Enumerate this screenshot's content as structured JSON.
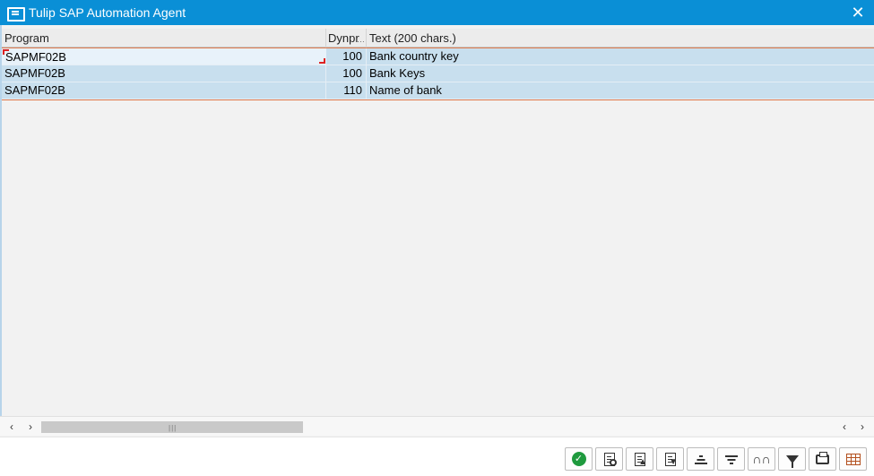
{
  "window": {
    "title": "Tulip SAP Automation Agent",
    "close_icon": "close-icon",
    "app_icon": "window-icon",
    "accent_color": "#0a8fd6"
  },
  "grid": {
    "columns": [
      {
        "key": "program",
        "label": "Program"
      },
      {
        "key": "dynpr",
        "label": "Dynpr"
      },
      {
        "key": "text",
        "label": "Text (200 chars.)"
      }
    ],
    "rows": [
      {
        "program": "SAPMF02B",
        "dynpr": "100",
        "text": "Bank country key"
      },
      {
        "program": "SAPMF02B",
        "dynpr": "100",
        "text": "Bank Keys"
      },
      {
        "program": "SAPMF02B",
        "dynpr": "110",
        "text": "Name of bank"
      }
    ],
    "selection_color": "#c8dfee"
  },
  "scrollbar": {
    "left_arrow": "‹",
    "right_arrow": "›",
    "grip": "|||"
  },
  "toolbar": {
    "buttons": [
      {
        "name": "continue-button",
        "icon": "check-icon"
      },
      {
        "name": "find-button",
        "icon": "magnifier-doc-icon"
      },
      {
        "name": "sort-ascending-button",
        "icon": "doc-arrow-icon"
      },
      {
        "name": "sort-descending-button",
        "icon": "doc-arrow-icon"
      },
      {
        "name": "sort-up-button",
        "icon": "sort-up-icon"
      },
      {
        "name": "sort-down-button",
        "icon": "sort-down-icon"
      },
      {
        "name": "search-button",
        "icon": "binoculars-icon"
      },
      {
        "name": "filter-button",
        "icon": "funnel-icon"
      },
      {
        "name": "print-button",
        "icon": "printer-icon"
      },
      {
        "name": "layout-button",
        "icon": "table-icon"
      }
    ]
  }
}
